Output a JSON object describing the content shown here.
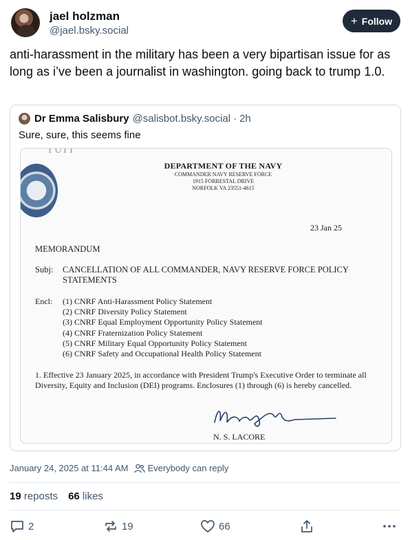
{
  "author": {
    "display_name": "jael holzman",
    "handle": "@jael.bsky.social",
    "follow_label": "Follow"
  },
  "post_text": "anti-harassment in the military has been a very bipartisan issue for as long as i’ve been a journalist in washington. going back to trump 1.0.",
  "quote": {
    "display_name": "Dr Emma Salisbury",
    "handle": "@salisbot.bsky.social",
    "separator": "·",
    "time": "2h",
    "text": "Sure, sure, this seems fine",
    "memo": {
      "stub_text": "TUIT",
      "dept": "DEPARTMENT OF THE NAVY",
      "command": "COMMANDER NAVY RESERVE FORCE",
      "address1": "1915 FORRESTAL DRIVE",
      "address2": "NORFOLK VA 23551-4615",
      "date": "23 Jan 25",
      "label": "MEMORANDUM",
      "subj_key": "Subj:",
      "subj_text": "CANCELLATION OF ALL COMMANDER, NAVY RESERVE FORCE POLICY STATEMENTS",
      "encl_key": "Encl:",
      "enclosures": [
        "(1) CNRF Anti-Harassment Policy Statement",
        "(2) CNRF Diversity Policy Statement",
        "(3) CNRF Equal Employment Opportunity Policy Statement",
        "(4) CNRF Fraternization Policy Statement",
        "(5) CNRF Military Equal Opportunity Policy Statement",
        "(6) CNRF Safety and Occupational Health Policy Statement"
      ],
      "paragraph": "1. Effective 23 January 2025, in accordance with President Trump's Executive Order to terminate all Diversity, Equity and Inclusion (DEI) programs. Enclosures (1) through (6) is hereby cancelled.",
      "signer": "N. S. LACORE"
    }
  },
  "meta": {
    "timestamp": "January 24, 2025 at 11:44 AM",
    "reply_setting": "Everybody can reply"
  },
  "stats": {
    "reposts_count": "19",
    "reposts_label": "reposts",
    "likes_count": "66",
    "likes_label": "likes"
  },
  "actions": {
    "reply_count": "2",
    "repost_count": "19",
    "like_count": "66"
  },
  "icons": {
    "follow": "plus-icon",
    "reply_setting": "people-icon",
    "reply": "speech-bubble-icon",
    "repost": "repost-arrows-icon",
    "like": "heart-icon",
    "share": "share-icon",
    "more": "more-dots-icon"
  },
  "colors": {
    "follow_bg": "#1f2b3a",
    "muted_text": "#42576c",
    "border": "#d4dbe2"
  }
}
